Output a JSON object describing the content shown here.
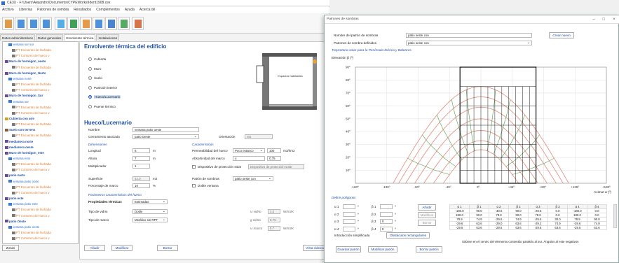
{
  "title_bar": "CE3X - F:\\Users\\Alejandro\\Documents\\CYPEWorks\\Ident1908.cex",
  "menu": [
    "Archivo",
    "Librerías",
    "Patrones de sombra",
    "Resultados",
    "Complementos",
    "Ayuda",
    "Acerca de"
  ],
  "toolbar_icons": [
    "new-file-icon",
    "open-folder-icon",
    "save-icon",
    "undo-icon",
    "calendar-icon",
    "energy-rating-icon",
    "orange-bars-icon",
    "chart-line-icon",
    "euro-icon",
    "green-building-icon",
    "report-icon"
  ],
  "tabs": [
    "Datos administrativos",
    "Datos generales",
    "Envolvente térmica",
    "Instalaciones"
  ],
  "active_tab": "Envolvente térmica",
  "tree": [
    {
      "level": 1,
      "text": "ventana sur sur",
      "icon": "window-icon"
    },
    {
      "level": 2,
      "text": "PT Encuentro de fachada",
      "icon": "bridge-icon"
    },
    {
      "level": 2,
      "text": "PT Contorno de hueco v",
      "icon": "bridge-icon"
    },
    {
      "level": 0,
      "text": "Muro de hormigon_oeste",
      "icon": "wall-icon"
    },
    {
      "level": 2,
      "text": "PT Encuentro de fachada",
      "icon": "bridge-icon"
    },
    {
      "level": 0,
      "text": "Muro de hormigon_Norte",
      "icon": "wall-icon"
    },
    {
      "level": 1,
      "text": "ventana norte",
      "icon": "window-icon"
    },
    {
      "level": 2,
      "text": "PT Encuentro de fachada",
      "icon": "bridge-icon"
    },
    {
      "level": 2,
      "text": "PT Contorno de hueco v",
      "icon": "bridge-icon"
    },
    {
      "level": 0,
      "text": "Muro de hormigon_Sur",
      "icon": "wall-icon"
    },
    {
      "level": 1,
      "text": "ventana sur",
      "icon": "window-icon"
    },
    {
      "level": 2,
      "text": "PT Encuentro de fachada",
      "icon": "bridge-icon"
    },
    {
      "level": 2,
      "text": "PT Contorno de hueco v",
      "icon": "bridge-icon"
    },
    {
      "level": 0,
      "text": "Cubierta con aire",
      "icon": "roof-icon"
    },
    {
      "level": 2,
      "text": "PT Encuentro de fachada",
      "icon": "bridge-icon"
    },
    {
      "level": 0,
      "text": "Suelo con terreno",
      "icon": "floor-icon"
    },
    {
      "level": 2,
      "text": "PT Encuentro de fachada",
      "icon": "bridge-icon"
    },
    {
      "level": 0,
      "text": "medianera norte",
      "icon": "wall-icon"
    },
    {
      "level": 0,
      "text": "medianera oeste",
      "icon": "wall-icon"
    },
    {
      "level": 0,
      "text": "Muro de hormigon_este",
      "icon": "wall-icon"
    },
    {
      "level": 1,
      "text": "ventana este",
      "icon": "window-icon"
    },
    {
      "level": 2,
      "text": "PT Encuentro de fachada",
      "icon": "bridge-icon"
    },
    {
      "level": 2,
      "text": "PT Contorno de hueco v",
      "icon": "bridge-icon"
    },
    {
      "level": 0,
      "text": "patio norte",
      "icon": "wall-icon"
    },
    {
      "level": 1,
      "text": "ventana patio norte",
      "icon": "window-icon"
    },
    {
      "level": 2,
      "text": "PT Encuentro de fachada",
      "icon": "bridge-icon"
    },
    {
      "level": 2,
      "text": "PT Contorno de hueco v",
      "icon": "bridge-icon"
    },
    {
      "level": 0,
      "text": "patio este",
      "icon": "wall-icon"
    },
    {
      "level": 1,
      "text": "ventana patio este",
      "icon": "window-icon"
    },
    {
      "level": 2,
      "text": "PT Encuentro de fachada",
      "icon": "bridge-icon"
    },
    {
      "level": 2,
      "text": "PT Contorno de hueco v",
      "icon": "bridge-icon"
    },
    {
      "level": 0,
      "text": "patio Oeste",
      "icon": "wall-icon"
    },
    {
      "level": 1,
      "text": "ventana patio oeste",
      "icon": "window-icon"
    },
    {
      "level": 2,
      "text": "PT Encuentro de fachada",
      "icon": "bridge-icon"
    },
    {
      "level": 2,
      "text": "PT Contorno de hueco v",
      "icon": "bridge-icon"
    }
  ],
  "zonas_label": "Zonas",
  "envolvente": {
    "title": "Envolvente térmica del edificio",
    "options": [
      "Cubierta",
      "Muro",
      "Suelo",
      "Partición interior",
      "Hueco/Lucernario",
      "Puente térmico"
    ],
    "selected": "Hueco/Lucernario",
    "diagram_label": "Espacios habitables"
  },
  "hueco": {
    "title": "Hueco/Lucernario",
    "nombre_label": "Nombre",
    "nombre_value": "ventana patio oeste",
    "cerramiento_label": "Cerramiento asociado",
    "cerramiento_value": "patio Oeste",
    "orientacion_label": "Orientación",
    "orientacion_value": "SO",
    "dimensiones_label": "Dimensiones",
    "longitud_label": "Longitud",
    "longitud_value": "6",
    "longitud_unit": "m",
    "altura_label": "Altura",
    "altura_value": "7",
    "altura_unit": "m",
    "multiplicador_label": "Multiplicador",
    "multiplicador_value": "1",
    "superficie_label": "Superficie",
    "superficie_value": "42.0",
    "superficie_unit": "m2",
    "marco_label": "Porcentaje de marco",
    "marco_value": "10",
    "marco_unit": "%",
    "caracteristicas_label": "Características",
    "permeabilidad_label": "Permeabilidad del hueco",
    "permeabilidad_value": "Poco estanco",
    "permeabilidad_num": "100",
    "permeabilidad_unit": "m3/hm2",
    "absortividad_label": "Absortividad del marco",
    "absortividad_value": "0.75",
    "proteccion_label": "Dispositivo de protección solar",
    "proteccion_placeholder": "Dispositivo de protección solar",
    "patron_label": "Patrón de sombras",
    "patron_value": "patio oeste con",
    "doble_label": "Doble ventana",
    "params_label": "Parámetros característicos del hueco",
    "prop_label": "Propiedades térmicas",
    "prop_value": "Estimadas",
    "vidrio_label": "Tipo de vidrio",
    "vidrio_value": "Doble",
    "marco_tipo_label": "Tipo de marco",
    "marco_tipo_value": "Metálico sin RPT",
    "u_vidrio_label": "U vidrio",
    "u_vidrio_value": "3.3",
    "u_vidrio_unit": "W/m2K",
    "g_vidrio_label": "g vidrio",
    "g_vidrio_value": "0.75",
    "u_marco_label": "U marco",
    "u_marco_value": "5.7",
    "u_marco_unit": "W/m2K",
    "anadir": "Añadir",
    "modificar": "Modificar",
    "borrar": "Borrar",
    "vista_clasica": "Vista clásica"
  },
  "dialog": {
    "title": "Patrones de sombras",
    "nombre_label": "Nombre del patrón de sombras",
    "nombre_value": "patio oeste con",
    "crear_nuevo": "Crear nuevo",
    "definidos_label": "Patrones de sombra definidos",
    "definidos_value": "patio oeste con",
    "chart_title": "Trayectoria solar para la Península Ibérica y Baleares",
    "poligonos_label": "Definir polígonos",
    "inputs": [
      {
        "label": "α 1",
        "value": ""
      },
      {
        "label": "β 1",
        "value": ""
      },
      {
        "label": "α 2",
        "value": ""
      },
      {
        "label": "β 2",
        "value": ""
      },
      {
        "label": "α 3",
        "value": ""
      },
      {
        "label": "β 3",
        "value": "0"
      },
      {
        "label": "α 4",
        "value": ""
      },
      {
        "label": "β 4",
        "value": "0"
      }
    ],
    "btn_anadir": "Añadir",
    "btn_modificar": "Modificar",
    "btn_borrar": "Borrar",
    "intro_label": "Introducción simplificada",
    "obstaculos_btn": "Obstáculos rectangulares",
    "table_headers": [
      "α 1",
      "β 1",
      "α 2",
      "β 2",
      "α 3",
      "β 3",
      "α 4",
      "β 4"
    ],
    "table_rows": [
      [
        "-180.0",
        "90.0",
        "-30.6",
        "90.0",
        "-29.6",
        "0.0",
        "-180.0",
        "0.0"
      ],
      [
        "180.0",
        "90.0",
        "78.9",
        "90.0",
        "78.9",
        "0.0",
        "180.0",
        "0.0"
      ],
      [
        "78.9",
        "74.9",
        "-29.6",
        "74.9",
        "-29.6",
        "30.0",
        "78.9",
        "90.0"
      ],
      [
        "-29.6",
        "63.6",
        "-29.0",
        "63.6",
        "-29.2",
        "74.9",
        "-29.6",
        "74.9"
      ],
      [
        "-29.6",
        "63.6",
        "-29.6",
        "63.6",
        "-29.6",
        "63.6",
        "-29.6",
        "63.6"
      ]
    ],
    "footnote": "Sitúese en el centro del elemento contenido paralelo al sur. Ángulos al este negativos",
    "guardar": "Guardar patrón",
    "modificar_patron": "Modificar patrón",
    "borrar_patron": "Borrar patrón"
  },
  "chart_data": {
    "type": "line",
    "title": "Trayectoria solar para la Península Ibérica y Baleares",
    "ylabel": "Elevación β (º)",
    "xlabel": "Acimut α (º)",
    "xlim": [
      -180,
      180
    ],
    "ylim": [
      0,
      90
    ],
    "x_ticks": [
      -180,
      -135,
      -90,
      -45,
      0,
      45,
      90,
      135,
      180
    ],
    "x_tick_labels": [
      "-180º",
      "-135º",
      "-90º",
      "-45º",
      "0º",
      "+45º",
      "+90º",
      "+135º",
      "+180º"
    ],
    "y_ticks": [
      0,
      10,
      20,
      30,
      40,
      50,
      60,
      70,
      80,
      90
    ],
    "y_tick_labels": [
      "",
      "10º",
      "20º",
      "30º",
      "40º",
      "50º",
      "60º",
      "70º",
      "80º",
      "90º"
    ],
    "sun_paths_max_elevation": [
      26,
      33,
      41,
      50,
      59,
      67,
      75
    ],
    "sun_paths_azimuth_span": [
      54,
      68,
      82,
      95,
      108,
      118,
      126
    ],
    "obstacle_polygon": [
      [
        -30,
        90
      ],
      [
        79,
        90
      ],
      [
        79,
        0
      ],
      [
        -30,
        0
      ]
    ],
    "grid": true,
    "colors": {
      "paths": "#e08a7a",
      "hours": "#6aa86a",
      "obstacle": "#111111",
      "axes": "#888888"
    }
  }
}
